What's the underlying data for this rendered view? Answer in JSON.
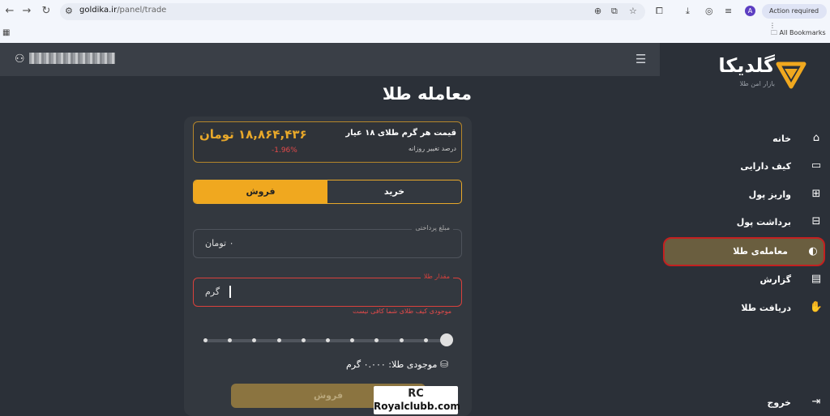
{
  "browser": {
    "url_host": "goldika.ir",
    "url_path": "/panel/trade",
    "profile_initial": "A",
    "action_required": "Action required",
    "all_bookmarks": "All Bookmarks"
  },
  "header": {
    "menu_icon": "hamburger-icon",
    "user_icon": "user-icon"
  },
  "page": {
    "title": "معامله طلا"
  },
  "price_box": {
    "label": "قیمت هر گرم طلای ۱۸ عیار",
    "value": "۱۸,۸۶۴,۴۳۶ تومان",
    "daily_change_label": "درصد تغییر روزانه",
    "daily_change": "-1.96%"
  },
  "tabs": {
    "buy": "خرید",
    "sell": "فروش",
    "active": "sell"
  },
  "form": {
    "amount_label": "مبلغ پرداختی",
    "amount_value": "۰ تومان",
    "gold_label": "مقدار طلا",
    "gold_value": "گرم",
    "error": "موجودی کیف طلای شما کافی نیست",
    "slider_percent": 100,
    "balance": "موجودی طلا: ۰.۰۰۰ گرم",
    "submit": "فروش"
  },
  "sidebar": {
    "logo_text": "گلدیکا",
    "logo_tagline": "بازار امن طلا",
    "items": [
      {
        "label": "خانه",
        "icon": "home-icon"
      },
      {
        "label": "کیف دارایی",
        "icon": "wallet-icon"
      },
      {
        "label": "واریز پول",
        "icon": "deposit-icon"
      },
      {
        "label": "برداشت پول",
        "icon": "withdraw-icon"
      },
      {
        "label": "معامله‌ی طلا",
        "icon": "trade-icon"
      },
      {
        "label": "گزارش",
        "icon": "report-icon"
      },
      {
        "label": "دریافت طلا",
        "icon": "receive-gold-icon"
      },
      {
        "label": "خروج",
        "icon": "logout-icon"
      }
    ]
  },
  "watermark": {
    "mark": "RC",
    "text": "Royalclubb.com"
  },
  "colors": {
    "accent": "#f0a81f",
    "error": "#e34a4a",
    "background": "#2b3038"
  }
}
